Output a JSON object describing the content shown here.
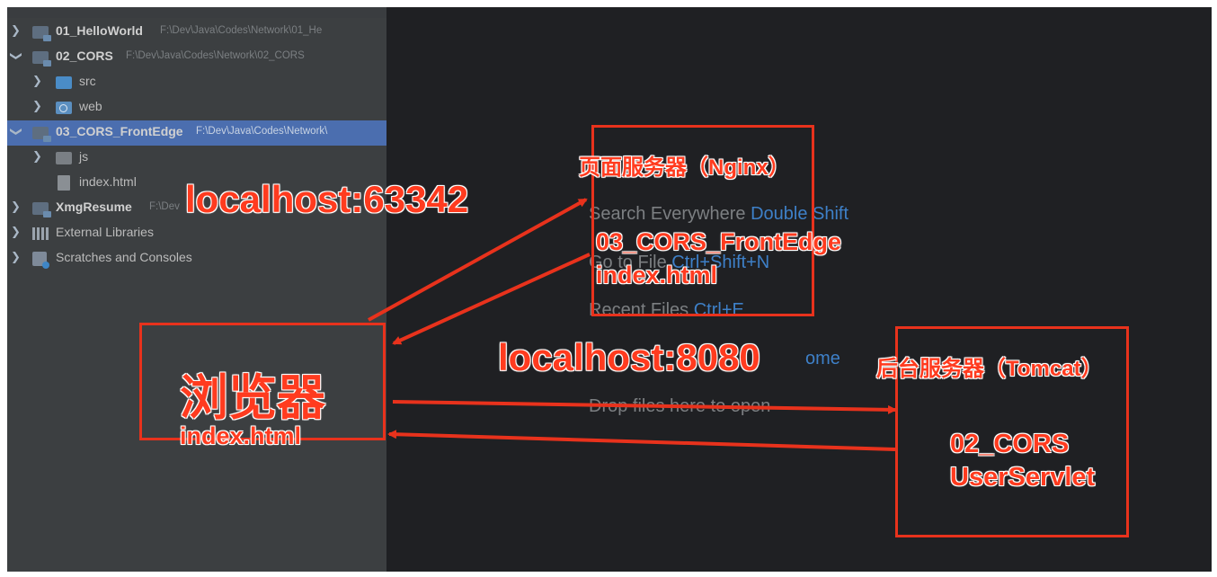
{
  "project_tree": {
    "rows": [
      {
        "name": "01_HelloWorld",
        "path": "F:\\Dev\\Java\\Codes\\Network\\01_He"
      },
      {
        "name": "02_CORS",
        "path": "F:\\Dev\\Java\\Codes\\Network\\02_CORS"
      },
      {
        "name": "src"
      },
      {
        "name": "web"
      },
      {
        "name": "03_CORS_FrontEdge",
        "path": "F:\\Dev\\Java\\Codes\\Network\\"
      },
      {
        "name": "js"
      },
      {
        "name": "index.html"
      },
      {
        "name": "XmgResume",
        "path": "F:\\Dev"
      },
      {
        "name": "External Libraries"
      },
      {
        "name": "Scratches and Consoles"
      }
    ]
  },
  "welcome_hints": {
    "search_everywhere": {
      "label": "Search Everywhere",
      "shortcut": "Double Shift"
    },
    "go_to_file": {
      "label": "Go to File",
      "shortcut": "Ctrl+Shift+N"
    },
    "recent_files": {
      "label": "Recent Files",
      "shortcut": "Ctrl+E"
    },
    "nav_bar_fragment": {
      "shortcut": "ome"
    },
    "drop_files": {
      "label": "Drop files here to open"
    }
  },
  "annotations": {
    "page_server_title": "页面服务器（Nginx）",
    "page_server_project": "03_CORS_FrontEdge",
    "page_server_file": "index.html",
    "browser_title": "浏览器",
    "browser_file": "index.html",
    "backend_server_title": "后台服务器（Tomcat）",
    "backend_project": "02_CORS",
    "backend_servlet": "UserServlet",
    "port_front": "localhost:63342",
    "port_back": "localhost:8080"
  },
  "colors": {
    "annotation_red": "#ff3b1f",
    "ide_panel_bg": "#3c3f41",
    "editor_bg": "#1f2023",
    "selection_blue": "#4b6eaf",
    "shortcut_blue": "#3e80c8"
  }
}
